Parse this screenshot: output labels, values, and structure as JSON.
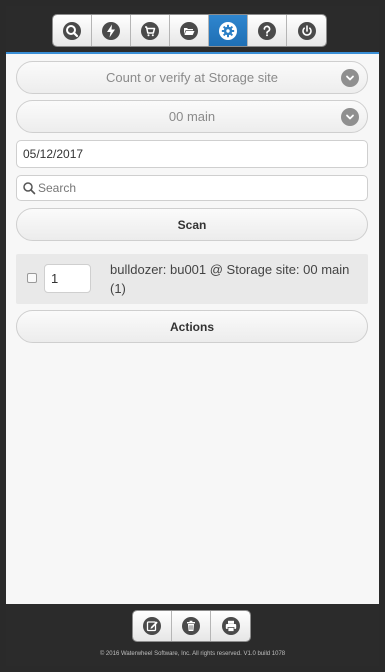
{
  "header": {
    "nav": [
      {
        "name": "search-icon"
      },
      {
        "name": "lightning-icon"
      },
      {
        "name": "cart-icon"
      },
      {
        "name": "folder-open-icon"
      },
      {
        "name": "gear-icon",
        "active": true
      },
      {
        "name": "help-icon"
      },
      {
        "name": "power-icon"
      }
    ]
  },
  "form": {
    "mode_select": "Count or verify at Storage site",
    "site_select": "00 main",
    "date_value": "05/12/2017",
    "search_placeholder": "Search",
    "scan_label": "Scan",
    "actions_label": "Actions"
  },
  "items": [
    {
      "quantity": "1",
      "description": "bulldozer: bu001 @ Storage site: 00 main (1)",
      "checked": false
    }
  ],
  "footer": {
    "buttons": [
      "edit-icon",
      "trash-icon",
      "print-icon"
    ],
    "copyright": "© 2016 Waterwheel Software, Inc. All rights reserved. V1.0 build 1078"
  },
  "colors": {
    "accent": "#2a7fc6",
    "bar_bg": "#2b2b2b"
  }
}
